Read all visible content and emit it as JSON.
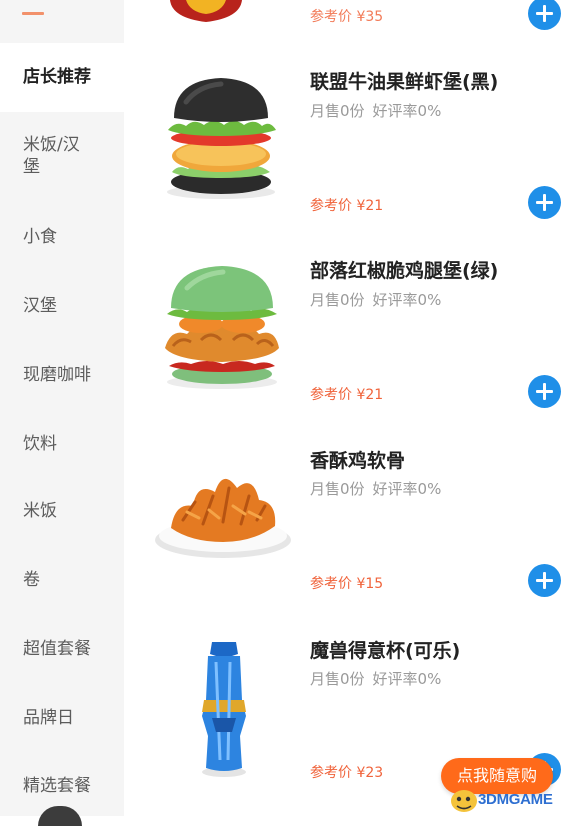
{
  "sidebar": {
    "items": [
      {
        "label": "店长推荐",
        "active": true
      },
      {
        "label": "米饭/汉堡",
        "active": false
      },
      {
        "label": "小食",
        "active": false
      },
      {
        "label": "汉堡",
        "active": false
      },
      {
        "label": "现磨咖啡",
        "active": false
      },
      {
        "label": "饮料",
        "active": false
      },
      {
        "label": "米饭",
        "active": false
      },
      {
        "label": "卷",
        "active": false
      },
      {
        "label": "超值套餐",
        "active": false
      },
      {
        "label": "品牌日",
        "active": false
      },
      {
        "label": "精选套餐",
        "active": false
      }
    ]
  },
  "products": [
    {
      "title": "联盟牛油果鲜虾堡(黑)",
      "monthly_sales": "月售0份",
      "rating": "好评率0%",
      "price": "参考价 ¥21",
      "image_icon": "black-burger-image"
    },
    {
      "title": "部落红椒脆鸡腿堡(绿)",
      "monthly_sales": "月售0份",
      "rating": "好评率0%",
      "price": "参考价 ¥21",
      "image_icon": "green-burger-image"
    },
    {
      "title": "香酥鸡软骨",
      "monthly_sales": "月售0份",
      "rating": "好评率0%",
      "price": "参考价 ¥15",
      "image_icon": "chicken-cartilage-image"
    },
    {
      "title": "魔兽得意杯(可乐)",
      "monthly_sales": "月售0份",
      "rating": "好评率0%",
      "price": "参考价 ¥23",
      "image_icon": "warcraft-cup-image"
    }
  ],
  "top_partial": {
    "price": "参考价 ¥35"
  },
  "random_order_button": {
    "label": "点我随意购"
  },
  "watermark": {
    "text": "3DMGAME"
  },
  "colors": {
    "accent_blue": "#1f8fe8",
    "price_orange": "#f0643c",
    "random_btn_orange": "#ff6a1a",
    "sidebar_bg": "#f5f5f5"
  }
}
